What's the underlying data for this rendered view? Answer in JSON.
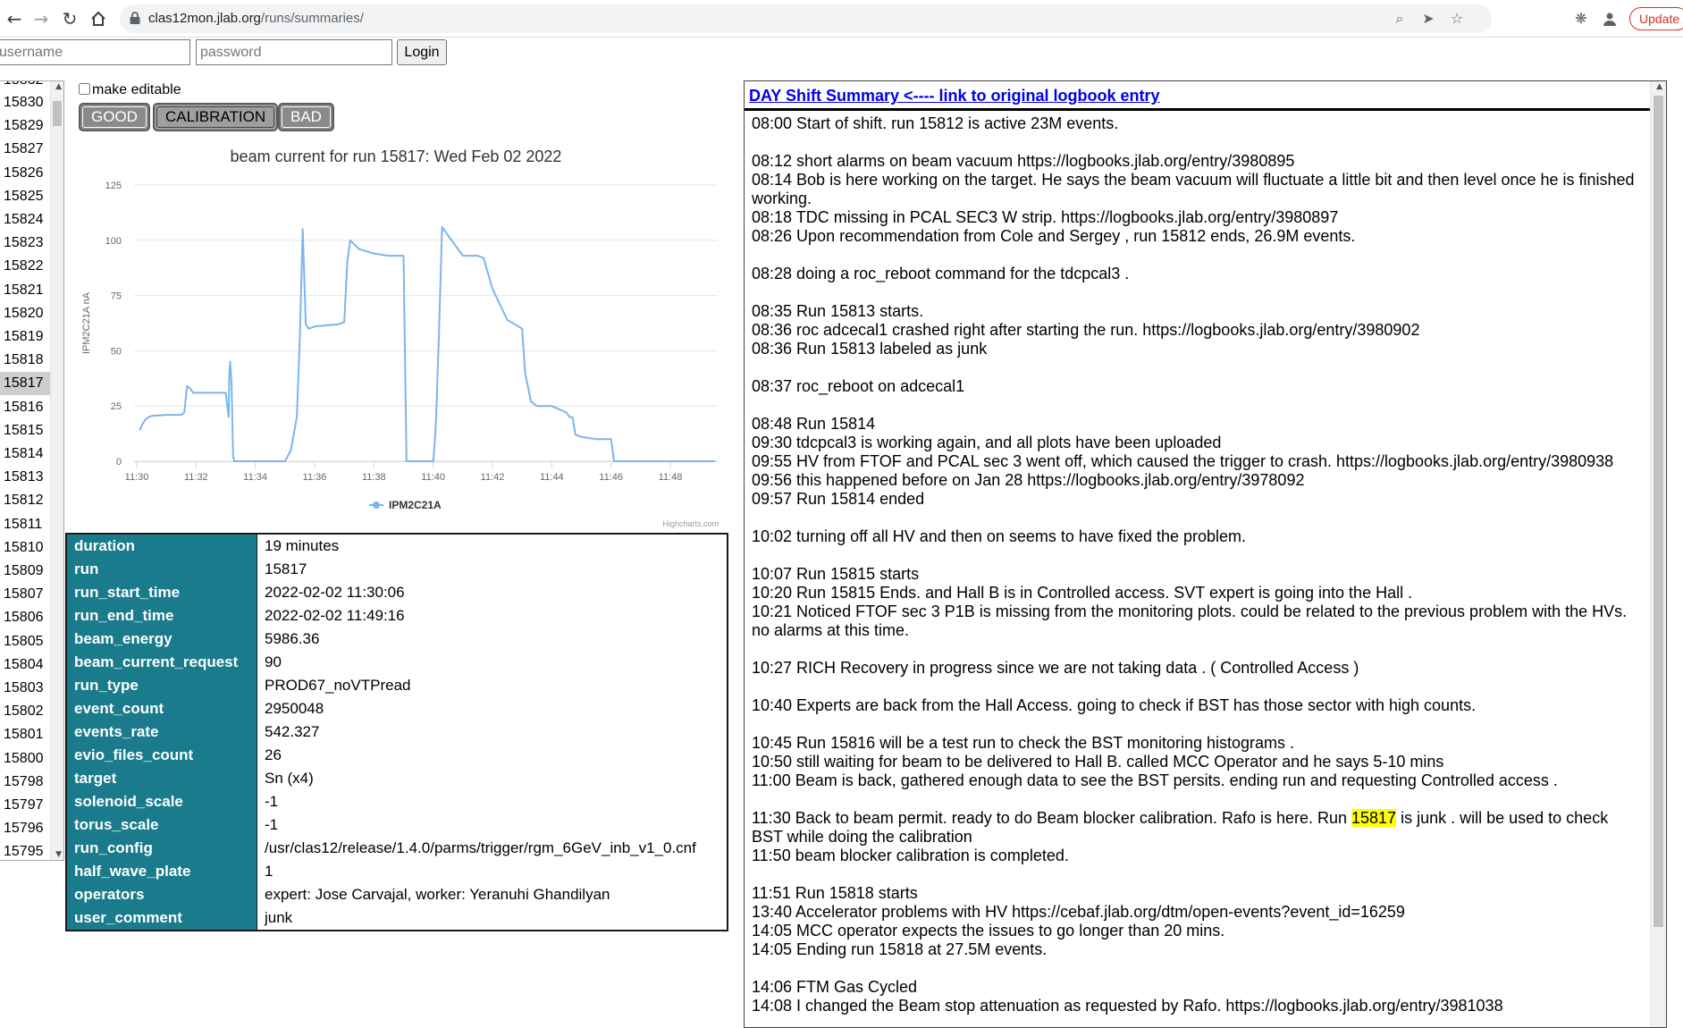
{
  "browser": {
    "url_host": "clas12mon.jlab.org",
    "url_path": "/runs/summaries/",
    "update_label": "Update",
    "icons": [
      "back-icon",
      "forward-icon",
      "reload-icon",
      "home-icon",
      "lock-icon",
      "zoom-icon",
      "send-icon",
      "star-icon",
      "extensions-icon",
      "profile-icon"
    ]
  },
  "login": {
    "username_placeholder": "username",
    "password_placeholder": "password",
    "button_label": "Login"
  },
  "runlist": {
    "partial_top": "15832",
    "items": [
      "15830",
      "15829",
      "15827",
      "15826",
      "15825",
      "15824",
      "15823",
      "15822",
      "15821",
      "15820",
      "15819",
      "15818",
      "15817",
      "15816",
      "15815",
      "15814",
      "15813",
      "15812",
      "15811",
      "15810",
      "15809",
      "15807",
      "15806",
      "15805",
      "15804",
      "15803",
      "15802",
      "15801",
      "15800",
      "15798",
      "15797",
      "15796"
    ],
    "partial_bottom": "15795",
    "selected": "15817"
  },
  "controls": {
    "make_editable_label": "make editable",
    "good_label": "GOOD",
    "calibration_label": "CALIBRATION",
    "bad_label": "BAD",
    "active_tag": "CALIBRATION"
  },
  "chart_data": {
    "type": "line",
    "title": "beam current for run 15817: Wed Feb 02 2022",
    "ylabel": "IPM2C21A nA",
    "xlabel": "",
    "credits": "Highcharts.com",
    "legend": "bottom-center",
    "grid": true,
    "ylim": [
      0,
      125
    ],
    "yticks": [
      0,
      25,
      50,
      75,
      100,
      125
    ],
    "xticks": [
      "11:30",
      "11:32",
      "11:34",
      "11:36",
      "11:38",
      "11:40",
      "11:42",
      "11:44",
      "11:46",
      "11:48"
    ],
    "xlim_minutes": [
      0,
      19.5
    ],
    "color": "#7cb5ec",
    "series": [
      {
        "name": "IPM2C21A",
        "x_minutes": [
          0.1,
          0.2,
          0.3,
          0.4,
          0.5,
          1.0,
          1.5,
          1.6,
          1.65,
          1.7,
          1.8,
          1.9,
          2.5,
          3.0,
          3.1,
          3.12,
          3.15,
          3.2,
          3.25,
          3.3,
          3.4,
          4.2,
          5.0,
          5.2,
          5.4,
          5.5,
          5.6,
          5.7,
          5.8,
          6.0,
          6.8,
          7.0,
          7.1,
          7.2,
          7.5,
          8.0,
          8.5,
          9.0,
          9.1,
          9.3,
          9.6,
          10.0,
          10.05,
          10.1,
          10.2,
          10.3,
          11.0,
          11.5,
          11.7,
          12.0,
          12.5,
          13.0,
          13.1,
          13.3,
          13.5,
          14.0,
          14.5,
          14.6,
          14.7,
          14.8,
          15.0,
          15.5,
          16.0,
          16.1,
          16.2,
          16.5,
          17.0,
          17.5,
          17.6,
          17.7,
          18.0,
          18.5,
          19.0,
          19.5
        ],
        "values": [
          14,
          17,
          19,
          20,
          20.5,
          21,
          21,
          22,
          28,
          34,
          33,
          31,
          31,
          31,
          20,
          38,
          45,
          35,
          2,
          0,
          0,
          0,
          0,
          5,
          20,
          55,
          105,
          62,
          60,
          61,
          62,
          63,
          90,
          100,
          96,
          94,
          93,
          93,
          0,
          0,
          0,
          0,
          8,
          20,
          60,
          106,
          93,
          93,
          92,
          78,
          64,
          60,
          40,
          27,
          25,
          25,
          22,
          20,
          20,
          12,
          11,
          10,
          10,
          0,
          0,
          0,
          0,
          0,
          0,
          0,
          0,
          0,
          0,
          0
        ]
      }
    ]
  },
  "info_rows": [
    {
      "key": "duration",
      "value": "19 minutes"
    },
    {
      "key": "run",
      "value": "15817"
    },
    {
      "key": "run_start_time",
      "value": "2022-02-02 11:30:06"
    },
    {
      "key": "run_end_time",
      "value": "2022-02-02 11:49:16"
    },
    {
      "key": "beam_energy",
      "value": "5986.36"
    },
    {
      "key": "beam_current_request",
      "value": "90"
    },
    {
      "key": "run_type",
      "value": "PROD67_noVTPread"
    },
    {
      "key": "event_count",
      "value": "2950048"
    },
    {
      "key": "events_rate",
      "value": "542.327"
    },
    {
      "key": "evio_files_count",
      "value": "26"
    },
    {
      "key": "target",
      "value": "Sn (x4)"
    },
    {
      "key": "solenoid_scale",
      "value": "-1"
    },
    {
      "key": "torus_scale",
      "value": "-1"
    },
    {
      "key": "run_config",
      "value": "/usr/clas12/release/1.4.0/parms/trigger/rgm_6GeV_inb_v1_0.cnf"
    },
    {
      "key": "half_wave_plate",
      "value": "1"
    },
    {
      "key": "operators",
      "value": "expert: Jose Carvajal, worker: Yeranuhi Ghandilyan"
    },
    {
      "key": "user_comment",
      "value": "junk"
    }
  ],
  "summary": {
    "header_link": "DAY Shift Summary <---- link to original logbook entry",
    "highlight_run": "15817",
    "paragraphs": [
      [
        "08:00 Start of shift. run 15812 is active 23M events."
      ],
      [
        "08:12 short alarms on beam vacuum https://logbooks.jlab.org/entry/3980895",
        "08:14 Bob is here working on the target. He says the beam vacuum will fluctuate a little bit and then level once he is finished working.",
        "08:18 TDC missing in PCAL SEC3 W strip. https://logbooks.jlab.org/entry/3980897",
        "08:26 Upon recommendation from Cole and Sergey , run 15812 ends, 26.9M events."
      ],
      [
        "08:28 doing a roc_reboot command for the tdcpcal3 ."
      ],
      [
        "08:35 Run 15813 starts.",
        "08:36 roc adcecal1 crashed right after starting the run. https://logbooks.jlab.org/entry/3980902",
        "08:36 Run 15813 labeled as junk"
      ],
      [
        "08:37 roc_reboot on adcecal1"
      ],
      [
        "08:48 Run 15814",
        "09:30 tdcpcal3 is working again, and all plots have been uploaded",
        "09:55 HV from FTOF and PCAL sec 3 went off, which caused the trigger to crash. https://logbooks.jlab.org/entry/3980938",
        "09:56 this happened before on Jan 28 https://logbooks.jlab.org/entry/3978092",
        "09:57 Run 15814 ended"
      ],
      [
        "10:02 turning off all HV and then on seems to have fixed the problem."
      ],
      [
        "10:07 Run 15815 starts",
        "10:20 Run 15815 Ends. and Hall B is in Controlled access. SVT expert is going into the Hall .",
        "10:21 Noticed FTOF sec 3 P1B is missing from the monitoring plots. could be related to the previous problem with the HVs. no alarms at this time."
      ],
      [
        "10:27 RICH Recovery in progress since we are not taking data . ( Controlled Access )"
      ],
      [
        "10:40 Experts are back from the Hall Access. going to check if BST has those sector with high counts."
      ],
      [
        "10:45 Run 15816 will be a test run to check the BST monitoring histograms .",
        "10:50 still waiting for beam to be delivered to Hall B. called MCC Operator and he says 5-10 mins",
        "11:00 Beam is back, gathered enough data to see the BST persits. ending run and requesting Controlled access ."
      ],
      [
        "11:30 Back to beam permit. ready to do Beam blocker calibration. Rafo is here. Run 15817 is junk . will be used to check BST while doing the calibration",
        "11:50 beam blocker calibration is completed."
      ],
      [
        "11:51 Run 15818 starts",
        "13:40 Accelerator problems with HV https://cebaf.jlab.org/dtm/open-events?event_id=16259",
        "14:05 MCC operator expects the issues to go longer than 20 mins.",
        "14:05 Ending run 15818 at 27.5M events."
      ],
      [
        "14:06 FTM Gas Cycled",
        "14:08 I changed the Beam stop attenuation as requested by Rafo. https://logbooks.jlab.org/entry/3981038"
      ]
    ]
  }
}
